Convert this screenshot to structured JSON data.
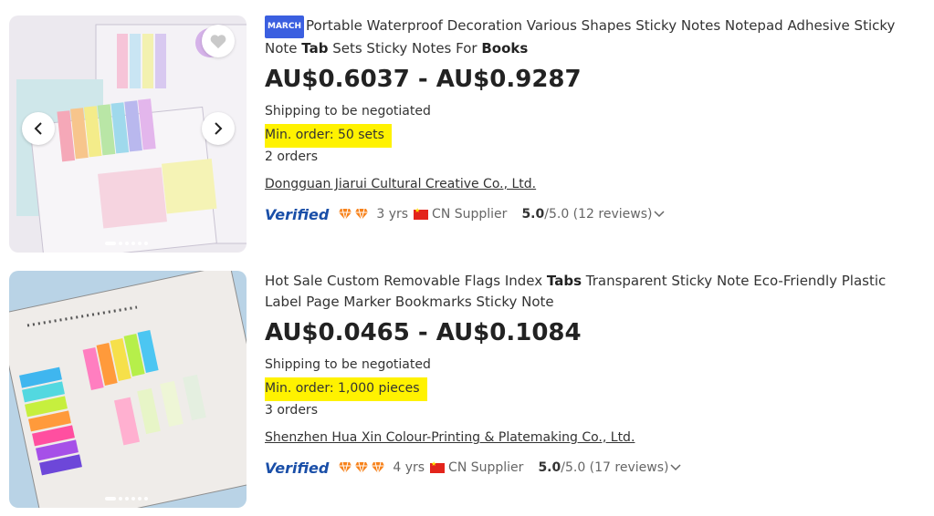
{
  "products": [
    {
      "badge": "MARCH",
      "title_parts": [
        "Portable Waterproof Decoration Various Shapes Sticky Notes Notepad Adhesive Sticky Note ",
        "Tab",
        " Sets Sticky Notes For ",
        "Books"
      ],
      "price": "AU$0.6037 - AU$0.9287",
      "shipping": "Shipping to be negotiated",
      "min_order": "Min. order: 50 sets",
      "orders": "2 orders",
      "supplier": "Dongguan Jiarui Cultural Creative Co., Ltd.",
      "verified": "Verified",
      "years": "3 yrs",
      "country": "CN Supplier",
      "rating_score": "5.0",
      "rating_rest": "/5.0 (12 reviews)",
      "gem_count": 2
    },
    {
      "badge": "",
      "title_parts": [
        "Hot Sale Custom Removable Flags Index ",
        "Tabs",
        " Transparent Sticky Note Eco-Friendly Plastic Label Page Marker Bookmarks Sticky Note",
        ""
      ],
      "price": "AU$0.0465 - AU$0.1084",
      "shipping": "Shipping to be negotiated",
      "min_order": "Min. order: 1,000 pieces",
      "orders": "3 orders",
      "supplier": "Shenzhen Hua Xin Colour-Printing & Platemaking Co., Ltd.",
      "verified": "Verified",
      "years": "4 yrs",
      "country": "CN Supplier",
      "rating_score": "5.0",
      "rating_rest": "/5.0 (17 reviews)",
      "gem_count": 3
    }
  ],
  "icons": {
    "favorite": "heart-icon",
    "prev": "chevron-left-icon",
    "next": "chevron-right-icon",
    "gem": "diamond-icon",
    "flag": "china-flag-icon",
    "expand": "chevron-down-icon"
  },
  "colors": {
    "highlight": "#fff200",
    "gem": "#f7821b",
    "verified": "#1a4fa8"
  }
}
